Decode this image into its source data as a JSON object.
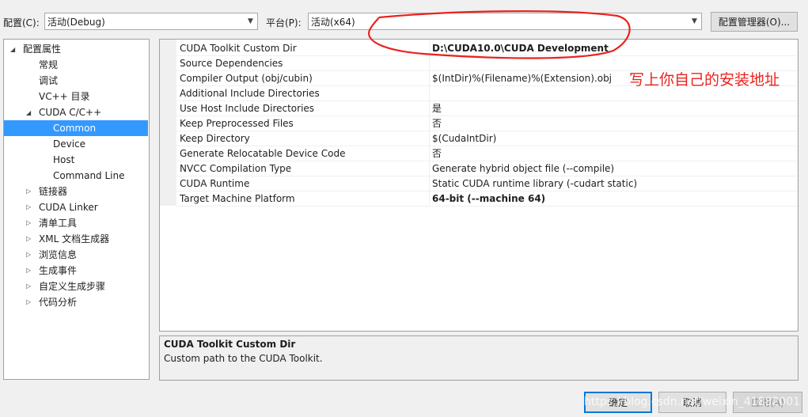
{
  "toolbar": {
    "config_label": "配置(C):",
    "config_value": "活动(Debug)",
    "platform_label": "平台(P):",
    "platform_value": "活动(x64)",
    "config_manager_label": "配置管理器(O)..."
  },
  "tree": {
    "root": "配置属性",
    "items": [
      {
        "label": "常规"
      },
      {
        "label": "调试"
      },
      {
        "label": "VC++ 目录"
      },
      {
        "label": "CUDA C/C++"
      },
      {
        "label": "Common"
      },
      {
        "label": "Device"
      },
      {
        "label": "Host"
      },
      {
        "label": "Command Line"
      },
      {
        "label": "链接器"
      },
      {
        "label": "CUDA Linker"
      },
      {
        "label": "清单工具"
      },
      {
        "label": "XML 文档生成器"
      },
      {
        "label": "浏览信息"
      },
      {
        "label": "生成事件"
      },
      {
        "label": "自定义生成步骤"
      },
      {
        "label": "代码分析"
      }
    ]
  },
  "grid": {
    "rows": [
      {
        "name": "CUDA Toolkit Custom Dir",
        "value": "D:\\CUDA10.0\\CUDA Development"
      },
      {
        "name": "Source Dependencies",
        "value": ""
      },
      {
        "name": "Compiler Output (obj/cubin)",
        "value": "$(IntDir)%(Filename)%(Extension).obj"
      },
      {
        "name": "Additional Include Directories",
        "value": ""
      },
      {
        "name": "Use Host Include Directories",
        "value": "是"
      },
      {
        "name": "Keep Preprocessed Files",
        "value": "否"
      },
      {
        "name": "Keep Directory",
        "value": "$(CudaIntDir)"
      },
      {
        "name": "Generate Relocatable Device Code",
        "value": "否"
      },
      {
        "name": "NVCC Compilation Type",
        "value": "Generate hybrid object file (--compile)"
      },
      {
        "name": "CUDA Runtime",
        "value": "Static CUDA runtime library (-cudart static)"
      },
      {
        "name": "Target Machine Platform",
        "value": "64-bit (--machine 64)"
      }
    ]
  },
  "annotation": {
    "text": "写上你自己的安装地址",
    "color": "#e8231f"
  },
  "description": {
    "title": "CUDA Toolkit Custom Dir",
    "text": "Custom path to the CUDA Toolkit."
  },
  "buttons": {
    "ok": "确定",
    "cancel": "取消",
    "apply": "应用(A)"
  },
  "watermark": "https://blog.csdn.net/weixin_41882001"
}
